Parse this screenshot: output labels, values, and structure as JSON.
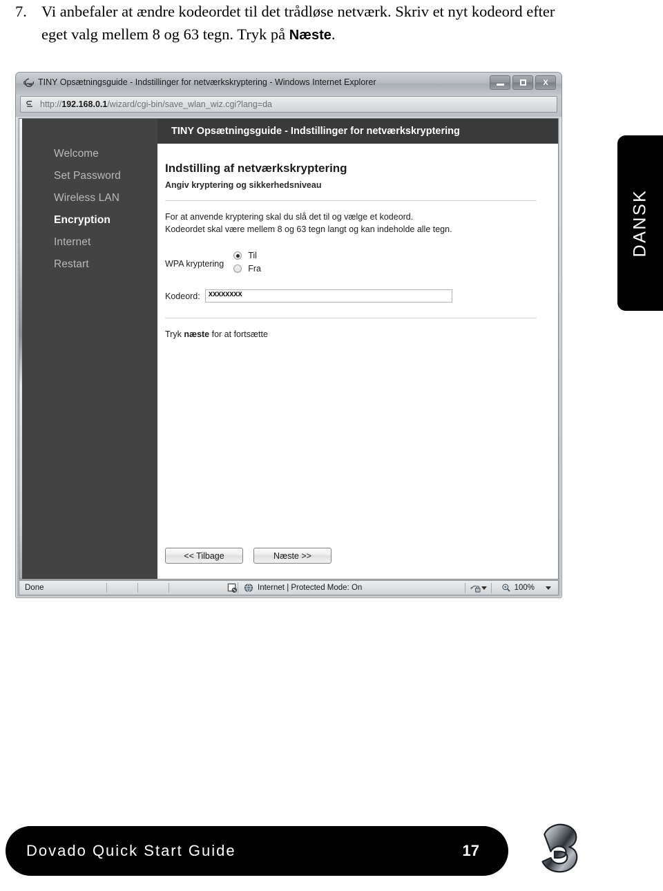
{
  "instruction": {
    "number": "7.",
    "text_part1": "Vi anbefaler at ændre kodeordet til det trådløse netværk. Skriv et nyt kodeord efter eget valg mellem 8 og 63 tegn. Tryk på ",
    "bold_word": "Næste",
    "text_part2": "."
  },
  "browser": {
    "window_title": "TINY Opsætningsguide - Indstillinger for netværkskryptering - Windows Internet Explorer",
    "minimize_label": "",
    "maximize_label": "",
    "close_label": "X",
    "address": {
      "scheme": "http://",
      "host": "192.168.0.1",
      "path": "/wizard/cgi-bin/save_wlan_wiz.cgi?lang=da"
    },
    "statusbar": {
      "status": "Done",
      "zone": "Internet | Protected Mode: On",
      "zoom": "100%"
    }
  },
  "sidebar": {
    "items": [
      {
        "label": "Welcome",
        "active": false
      },
      {
        "label": "Set Password",
        "active": false
      },
      {
        "label": "Wireless LAN",
        "active": false
      },
      {
        "label": "Encryption",
        "active": true
      },
      {
        "label": "Internet",
        "active": false
      },
      {
        "label": "Restart",
        "active": false
      }
    ]
  },
  "page": {
    "header": "TINY Opsætningsguide - Indstillinger for netværkskryptering",
    "section_title": "Indstilling af netværkskryptering",
    "section_subtitle": "Angiv kryptering og sikkerhedsniveau",
    "paragraph_line1": "For at anvende kryptering skal du slå det til og vælge et kodeord.",
    "paragraph_line2": "Kodeordet skal være mellem 8 og 63 tegn langt og kan indeholde alle tegn.",
    "wpa_label": "WPA kryptering",
    "radio_on_label": "Til",
    "radio_off_label": "Fra",
    "radio_selected": "Til",
    "password_label": "Kodeord:",
    "password_value": "xxxxxxxx",
    "footer_note_pre": "Tryk ",
    "footer_note_bold": "næste",
    "footer_note_post": " for at fortsætte",
    "button_back": "<< Tilbage",
    "button_next": "Næste >>"
  },
  "side_tab": {
    "label": "DANSK"
  },
  "doc_footer": {
    "title": "Dovado Quick Start Guide",
    "page_number": "17",
    "logo": "three-logo"
  }
}
